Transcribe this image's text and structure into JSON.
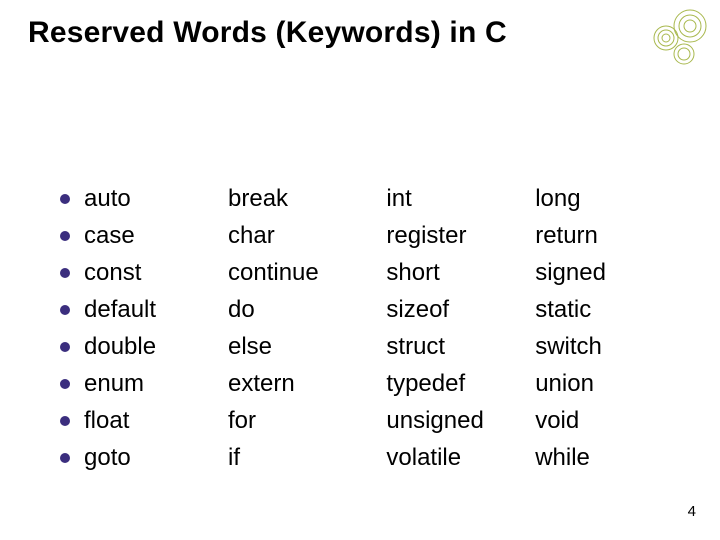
{
  "title": "Reserved Words (Keywords) in C",
  "columns": {
    "col1": [
      "auto",
      "case",
      "const",
      "default",
      "double",
      "enum",
      "float",
      "goto"
    ],
    "col2": [
      "break",
      "char",
      "continue",
      "do",
      "else",
      "extern",
      "for",
      "if"
    ],
    "col3": [
      "int",
      "register",
      "short",
      "sizeof",
      "struct",
      "typedef",
      "unsigned",
      "volatile"
    ],
    "col4": [
      "long",
      "return",
      "signed",
      "static",
      "switch",
      "union",
      "void",
      "while"
    ]
  },
  "page_number": "4",
  "colors": {
    "bullet": "#3b2e7e",
    "decor_stroke": "#a8b84d"
  }
}
